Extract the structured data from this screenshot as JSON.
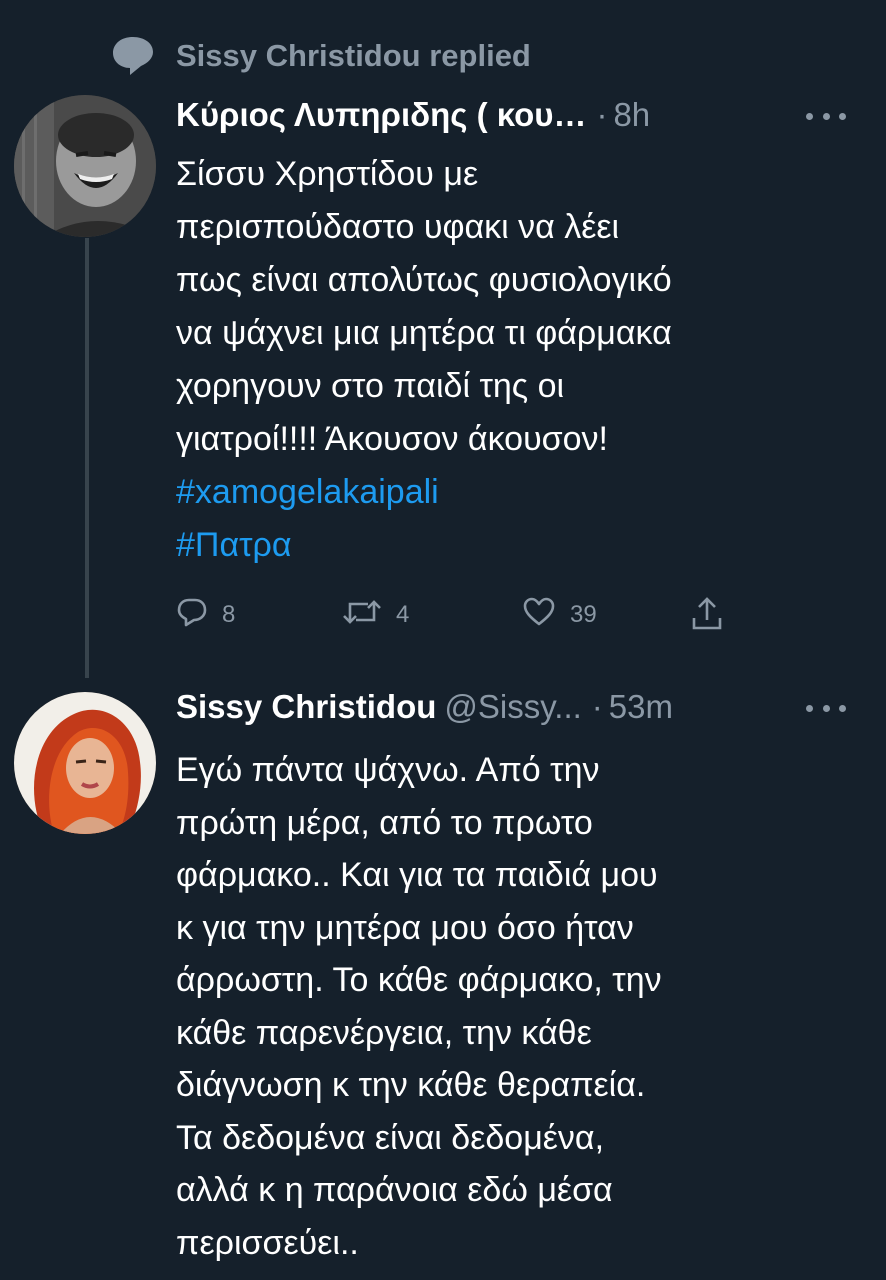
{
  "context": {
    "replied_text": "Sissy Christidou replied",
    "icon": "speech-bubble-icon"
  },
  "tweet1": {
    "author_name": "Κύριος Λυπηριδης ( κου…",
    "dot": "·",
    "time": "8h",
    "lines": [
      "Σίσσυ Χρηστίδου με",
      "περισπούδαστο υφακι να λέει",
      "πως είναι απολύτως φυσιολογικό",
      "να ψάχνει μια μητέρα τι φάρμακα",
      "χορηγουν στο παιδί της οι",
      "γιατροί!!!! Άκουσον άκουσον!"
    ],
    "hashtags": [
      "#xamogelakaipali",
      "#Πατρα"
    ],
    "actions": {
      "reply_count": "8",
      "retweet_count": "4",
      "like_count": "39"
    }
  },
  "tweet2": {
    "author_name": "Sissy Christidou",
    "handle": "@Sissy...",
    "dot": "·",
    "time": "53m",
    "lines": [
      "Εγώ πάντα ψάχνω. Από την",
      "πρώτη μέρα, από το πρωτο",
      "φάρμακο.. Και για τα παιδιά μου",
      "κ για την μητέρα μου όσο ήταν",
      "άρρωστη. Το κάθε φάρμακο, την",
      "κάθε παρενέργεια, την κάθε",
      "διάγνωση κ την κάθε θεραπεία.",
      "Τα δεδομένα είναι δεδομένα,",
      "αλλά κ η παράνοια εδώ μέσα",
      "περισσεύει.."
    ]
  },
  "colors": {
    "background": "#15202b",
    "text": "#ffffff",
    "muted": "#8b98a5",
    "link": "#1d9bf0"
  }
}
